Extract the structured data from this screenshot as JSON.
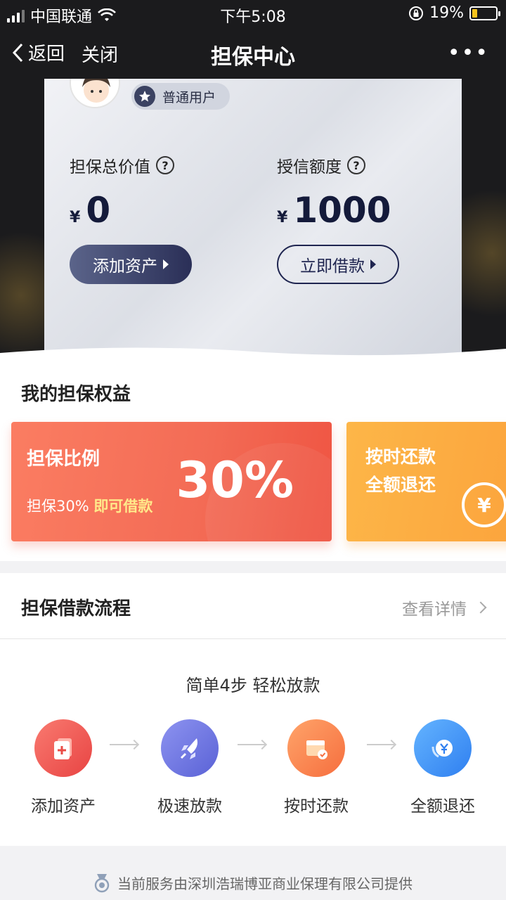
{
  "status_bar": {
    "carrier": "中国联通",
    "time": "下午5:08",
    "battery": "19%"
  },
  "nav": {
    "back_label": "返回",
    "close_label": "关闭",
    "title": "担保中心"
  },
  "card": {
    "user_level": "普通用户",
    "guarantee_total_label": "担保总价值",
    "guarantee_total_currency": "¥",
    "guarantee_total_value": "0",
    "credit_limit_label": "授信额度",
    "credit_limit_currency": "¥",
    "credit_limit_value": "1000",
    "add_asset_button": "添加资产",
    "borrow_now_button": "立即借款"
  },
  "benefits": {
    "title": "我的担保权益",
    "ratio_card": {
      "title": "担保比例",
      "subtitle_prefix": "担保30%",
      "subtitle_highlight": "即可借款",
      "percent": "30%"
    },
    "refund_card": {
      "line1": "按时还款",
      "line2": "全额退还"
    }
  },
  "process": {
    "title": "担保借款流程",
    "details_link": "查看详情",
    "subtitle": "简单4步  轻松放款",
    "steps": [
      {
        "label": "添加资产",
        "icon": "add-asset-icon"
      },
      {
        "label": "极速放款",
        "icon": "rocket-icon"
      },
      {
        "label": "按时还款",
        "icon": "calendar-check-icon"
      },
      {
        "label": "全额退还",
        "icon": "refund-yen-icon"
      }
    ]
  },
  "footer": {
    "provider_text": "当前服务由深圳浩瑞博亚商业保理有限公司提供"
  },
  "colors": {
    "dark_bg": "#1b1b1d",
    "accent_red": "#f36b55",
    "accent_orange": "#fba33c",
    "navy": "#1f2550"
  }
}
